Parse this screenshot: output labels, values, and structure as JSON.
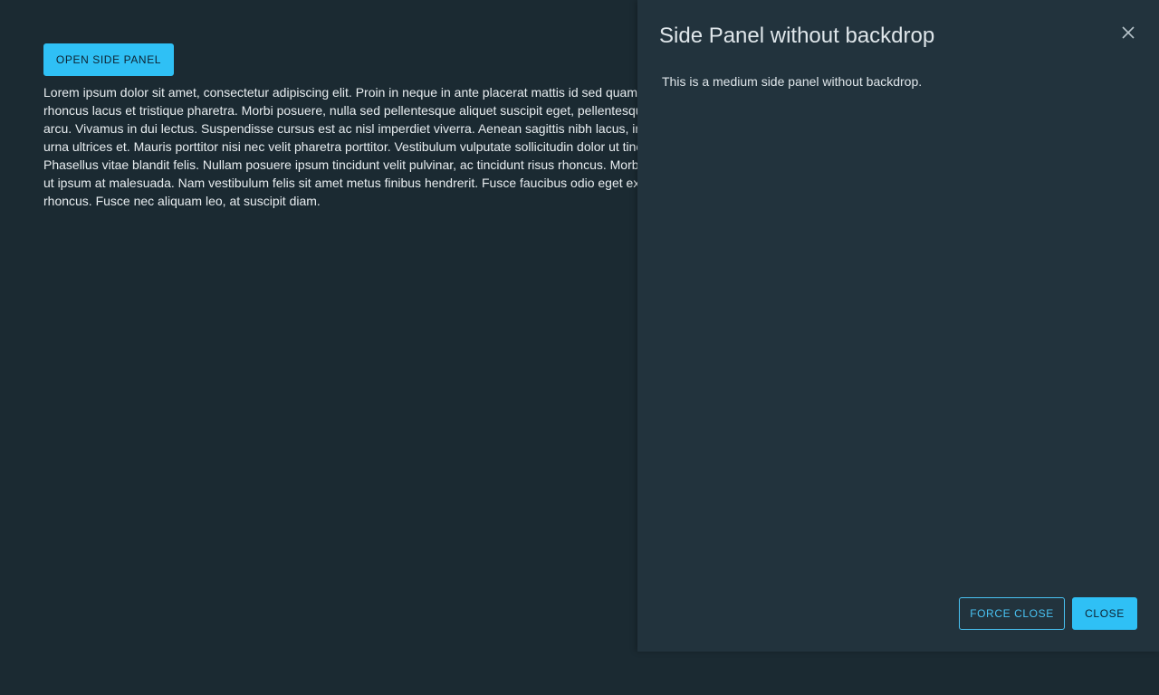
{
  "main": {
    "open_button_label": "OPEN SIDE PANEL",
    "lorem_text": "Lorem ipsum dolor sit amet, consectetur adipiscing elit. Proin in neque in ante placerat mattis id sed quam. Proin rhoncus lacus et tristique pharetra. Morbi posuere, nulla sed pellentesque aliquet suscipit eget, pellentesque sed arcu. Vivamus in dui lectus. Suspendisse cursus est ac nisl imperdiet viverra. Aenean sagittis nibh lacus, in eleifend urna ultrices et. Mauris porttitor nisi nec velit pharetra porttitor. Vestibulum vulputate sollicitudin dolor ut tincidunt. Phasellus vitae blandit felis. Nullam posuere ipsum tincidunt velit pulvinar, ac tincidunt risus rhoncus. Morbi faucibus ut ipsum at malesuada. Nam vestibulum felis sit amet metus finibus hendrerit. Fusce faucibus odio eget ex vulputate rhoncus. Fusce nec aliquam leo, at suscipit diam."
  },
  "panel": {
    "title": "Side Panel without backdrop",
    "body_text": "This is a medium side panel without backdrop.",
    "force_close_label": "FORCE CLOSE",
    "close_label": "CLOSE",
    "close_icon": "close-icon"
  },
  "colors": {
    "page_background": "#1b2a32",
    "panel_background": "#22333d",
    "accent": "#2fc0f5",
    "text": "#e8edf0"
  }
}
